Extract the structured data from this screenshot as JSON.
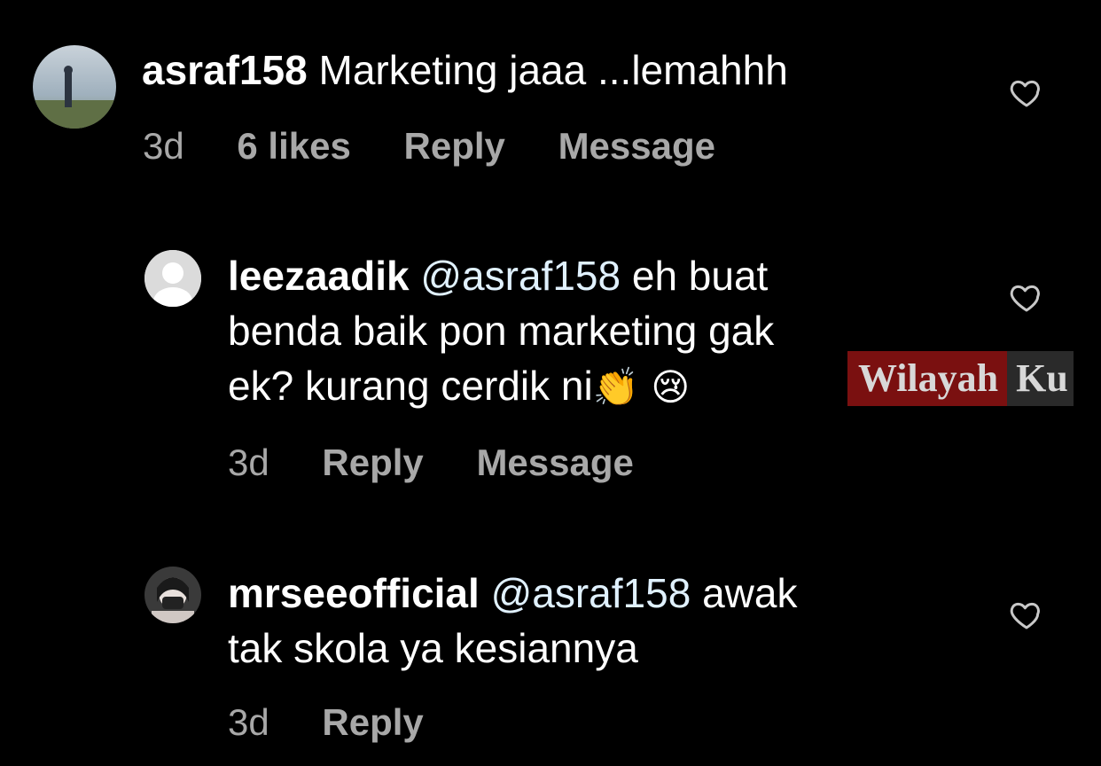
{
  "comments": [
    {
      "username": "asraf158",
      "mention": "",
      "text": "Marketing jaaa ...lemahhh",
      "emoji": "",
      "time": "3d",
      "likes": "6 likes",
      "reply_label": "Reply",
      "message_label": "Message"
    },
    {
      "username": "leezaadik",
      "mention": "@asraf158",
      "text_line1": "eh buat",
      "text_line2": "benda baik pon marketing gak",
      "text_line3": "ek? kurang cerdik ni",
      "emoji": "👏 😢",
      "time": "3d",
      "reply_label": "Reply",
      "message_label": "Message"
    },
    {
      "username": "mrseeofficial",
      "mention": "@asraf158",
      "text_line1": "awak",
      "text_line2": "tak skola ya kesiannya",
      "time": "3d",
      "reply_label": "Reply"
    }
  ],
  "watermark": {
    "part1": "Wilayah",
    "part2": "Ku"
  },
  "icons": {
    "like": "heart-outline-icon",
    "avatar_default": "default-avatar-icon"
  },
  "colors": {
    "background": "#000000",
    "text": "#ffffff",
    "meta": "#a8a8a8",
    "mention": "#e0f1ff",
    "watermark_red": "#7a1010"
  }
}
